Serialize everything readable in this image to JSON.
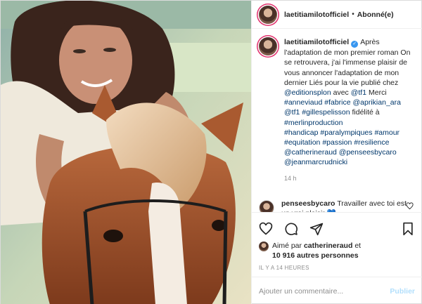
{
  "post": {
    "username": "laetitiamilotofficiel",
    "separator": "•",
    "follow_status": "Abonné(e)"
  },
  "caption": {
    "username": "laetitiamilotofficiel",
    "text_1": "Après l'adaptation de mon premier roman On se retrouvera, j'ai l'immense plaisir de vous annoncer l'adaptation de mon dernier Liés pour la vie publié chez ",
    "tag_editionsplon": "@editionsplon",
    "text_2": " avec ",
    "tag_tf1_a": "@tf1",
    "text_3": " Merci ",
    "tag_anneviaud": "#anneviaud",
    "tag_fabrice": "#fabrice",
    "tag_aprikian": "@aprikian_ara",
    "tag_tf1_b": "@tf1",
    "tag_gillespelisson": "#gillespelisson",
    "text_4": " fidélité à ",
    "tag_merlin": "#merlinproduction",
    "tag_handicap": "#handicap",
    "tag_paralympiques": "#paralympiques",
    "tag_amour": "#amour",
    "tag_equitation": "#equitation",
    "tag_passion": "#passion",
    "tag_resilience": "#resilience",
    "tag_catherineraud": "@catherineraud",
    "tag_penseesbycaro": "@penseesbycaro",
    "tag_jeanmarc": "@jeanmarcrudnicki",
    "time": "14 h"
  },
  "comment": {
    "username": "penseesbycaro",
    "text": "Travailler avec toi est un vrai plaisir",
    "emoji": "💙"
  },
  "likes": {
    "prefix": "Aimé par",
    "liker": "catherineraud",
    "connector": "et",
    "others": "10 916 autres personnes"
  },
  "timestamp": "IL Y A 14 HEURES",
  "add_comment": {
    "placeholder": "Ajouter un commentaire...",
    "publish": "Publier"
  },
  "icons": {
    "like": "heart-icon",
    "comment": "comment-icon",
    "share": "paper-plane-icon",
    "save": "bookmark-icon",
    "verified": "verified-badge-icon"
  },
  "colors": {
    "link": "#00376b",
    "verified": "#3897f0",
    "publish_disabled": "#b2dffc",
    "muted": "#8e8e8e"
  }
}
